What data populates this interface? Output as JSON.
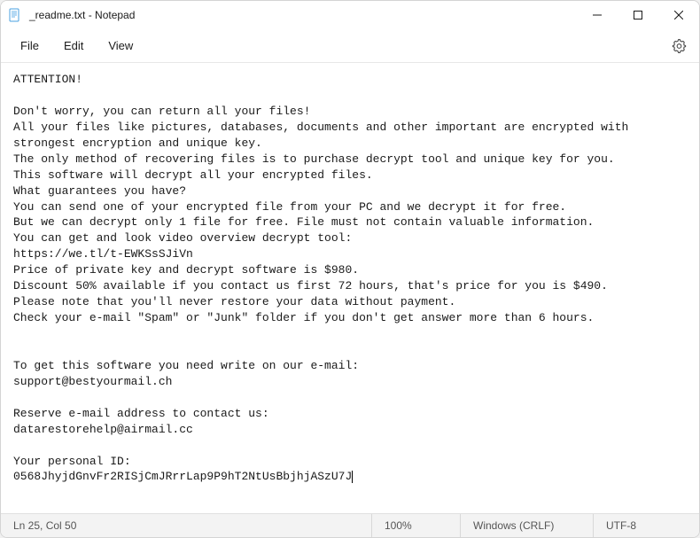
{
  "titlebar": {
    "title": "_readme.txt - Notepad"
  },
  "menu": {
    "file": "File",
    "edit": "Edit",
    "view": "View"
  },
  "body": {
    "text": "ATTENTION!\n\nDon't worry, you can return all your files!\nAll your files like pictures, databases, documents and other important are encrypted with strongest encryption and unique key.\nThe only method of recovering files is to purchase decrypt tool and unique key for you.\nThis software will decrypt all your encrypted files.\nWhat guarantees you have?\nYou can send one of your encrypted file from your PC and we decrypt it for free.\nBut we can decrypt only 1 file for free. File must not contain valuable information.\nYou can get and look video overview decrypt tool:\nhttps://we.tl/t-EWKSsSJiVn\nPrice of private key and decrypt software is $980.\nDiscount 50% available if you contact us first 72 hours, that's price for you is $490.\nPlease note that you'll never restore your data without payment.\nCheck your e-mail \"Spam\" or \"Junk\" folder if you don't get answer more than 6 hours.\n\n\nTo get this software you need write on our e-mail:\nsupport@bestyourmail.ch\n\nReserve e-mail address to contact us:\ndatarestorehelp@airmail.cc\n\nYour personal ID:\n0568JhyjdGnvFr2RISjCmJRrrLap9P9hT2NtUsBbjhjASzU7J"
  },
  "status": {
    "position": "Ln 25, Col 50",
    "zoom": "100%",
    "lineending": "Windows (CRLF)",
    "encoding": "UTF-8"
  }
}
